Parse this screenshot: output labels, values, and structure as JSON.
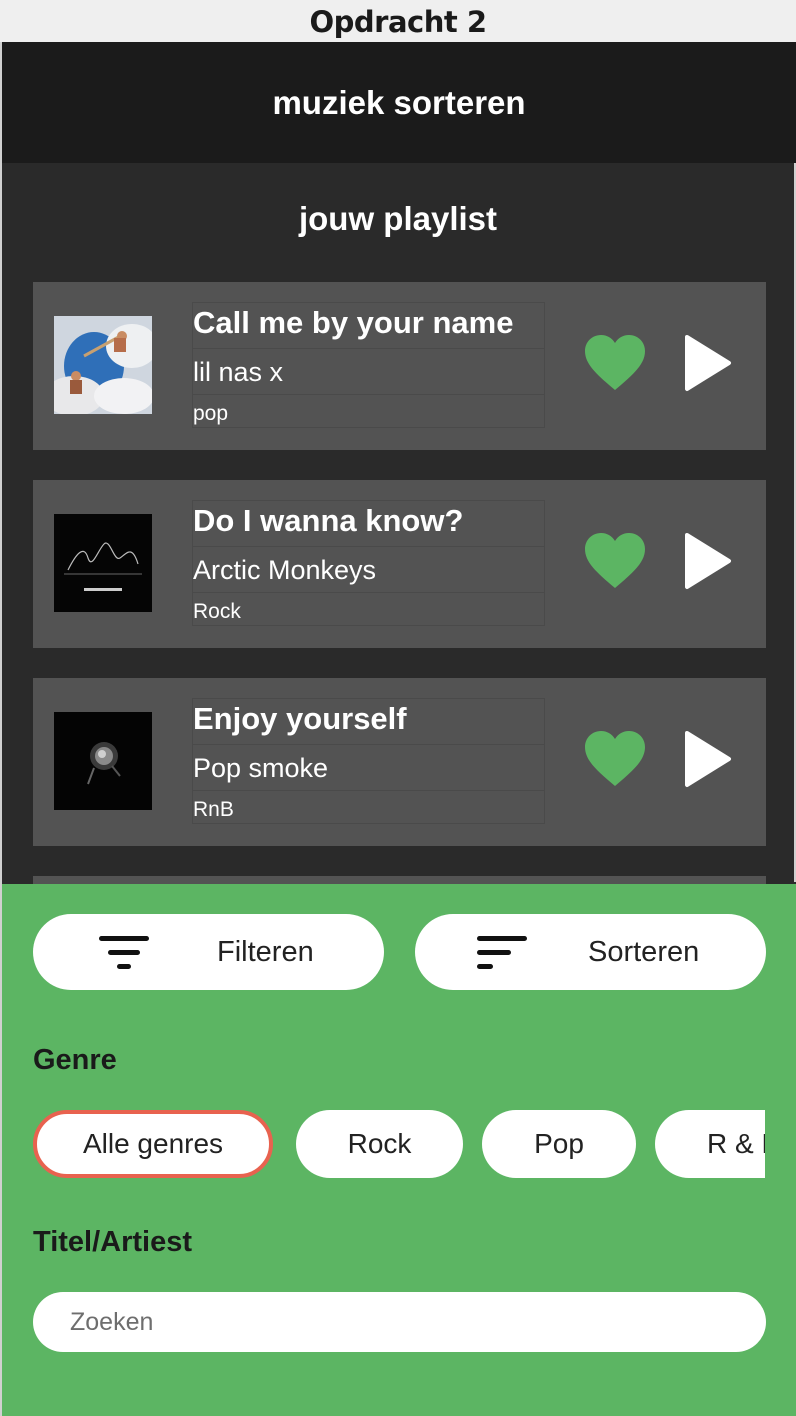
{
  "window": {
    "title": "Opdracht 2"
  },
  "header": {
    "title": "muziek sorteren"
  },
  "playlist": {
    "title": "jouw playlist",
    "tracks": [
      {
        "title": "Call me by your name",
        "artist": "lil nas x",
        "genre": "pop"
      },
      {
        "title": "Do I wanna know?",
        "artist": "Arctic Monkeys",
        "genre": "Rock"
      },
      {
        "title": "Enjoy yourself",
        "artist": "Pop smoke",
        "genre": "RnB"
      }
    ]
  },
  "controls": {
    "filter_label": "Filteren",
    "sort_label": "Sorteren",
    "genre_heading": "Genre",
    "genres": [
      "Alle genres",
      "Rock",
      "Pop",
      "R & B"
    ],
    "active_genre": "Alle genres",
    "search_heading": "Titel/Artiest",
    "search_placeholder": "Zoeken"
  },
  "colors": {
    "accent": "#5cb563",
    "active_outline": "#e8624f",
    "card": "#535353",
    "background": "#2a2a2a"
  },
  "icons": {
    "like": "heart-icon",
    "play": "play-icon",
    "filter": "filter-icon",
    "sort": "sort-icon"
  }
}
